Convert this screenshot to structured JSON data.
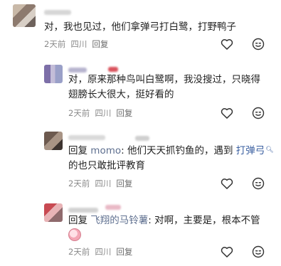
{
  "comments": [
    {
      "text": "对，我也见过，他们拿弹弓打白鹭，打野鸭子",
      "time": "2天前",
      "location": "四川",
      "reply_label": "回复"
    },
    {
      "line1": "对，原来那种鸟叫白鹭啊，我没搜过，只晓得",
      "line2": "翅膀长大很大，挺好看的",
      "time": "2天前",
      "location": "四川",
      "reply_label": "回复"
    },
    {
      "reply_prefix": "回复",
      "mention": "momo",
      "line1_body": ": 他们天天抓钓鱼的，遇到",
      "link": "打弹弓",
      "line2": "的也只敢批评教育",
      "time": "2天前",
      "location": "四川",
      "reply_label": "回复"
    },
    {
      "reply_prefix": "回复",
      "mention": "飞翔的马铃薯",
      "body": ": 对啊，主要是，根本不管",
      "time": "2天前",
      "location": "四川",
      "reply_label": "回复"
    }
  ],
  "icons": {
    "like": "heart-outline-icon",
    "emote": "smile-face-icon",
    "search_mark": "search-icon",
    "emoji": "face-emoji-icon"
  }
}
